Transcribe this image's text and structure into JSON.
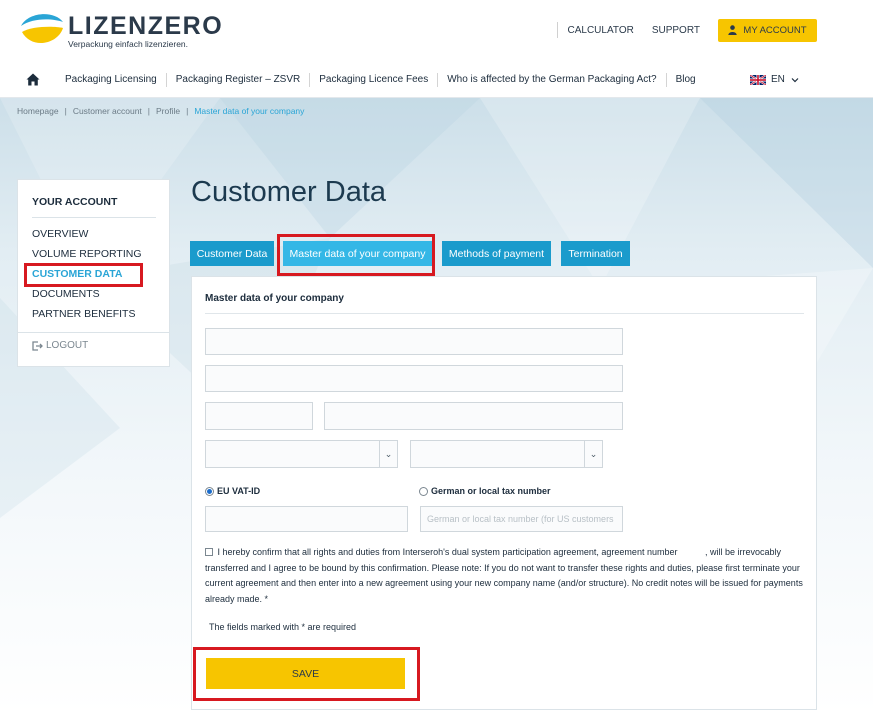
{
  "header": {
    "brand": "LIZENZERO",
    "tagline": "Verpackung einfach lizenzieren.",
    "links": [
      "CALCULATOR",
      "SUPPORT"
    ],
    "account_button": "MY ACCOUNT"
  },
  "nav": {
    "items": [
      "Packaging Licensing",
      "Packaging Register – ZSVR",
      "Packaging Licence Fees",
      "Who is affected by the German Packaging Act?",
      "Blog"
    ],
    "language": "EN"
  },
  "breadcrumb": [
    "Homepage",
    "Customer account",
    "Profile",
    "Master data of your company"
  ],
  "sidebar": {
    "title": "YOUR ACCOUNT",
    "items": [
      "OVERVIEW",
      "VOLUME REPORTING",
      "CUSTOMER DATA",
      "DOCUMENTS",
      "PARTNER BENEFITS"
    ],
    "active_index": 2,
    "logout": "LOGOUT"
  },
  "main": {
    "title": "Customer Data",
    "tabs": [
      "Customer Data",
      "Master data of your company",
      "Methods of payment",
      "Termination"
    ],
    "active_tab": 1
  },
  "form": {
    "section_title": "Master data of your company",
    "radio_vat": "EU VAT-ID",
    "radio_tax": "German or local tax number",
    "vat_selected": true,
    "tax_placeholder": "German or local tax number (for US customers",
    "consent_text": "I hereby confirm that all rights and duties from Interseroh's dual system participation agreement, agreement number           , will be irrevocably transferred and I agree to be bound by this confirmation. Please note: If you do not want to transfer these rights and duties, please first terminate your current agreement and then enter into a new agreement using your new company name (and/or structure). No credit notes will be issued for payments already made. *",
    "required_note": "The fields marked with * are required",
    "save_label": "SAVE"
  },
  "colors": {
    "accent_blue": "#1a9bcc",
    "active_blue": "#34b7e6",
    "brand_yellow": "#f7c500",
    "highlight_red": "#d71920"
  }
}
